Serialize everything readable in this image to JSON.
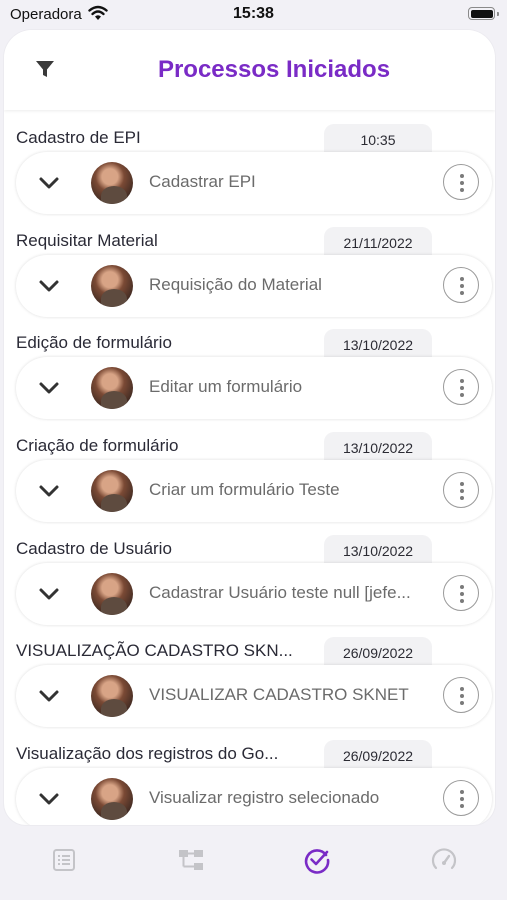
{
  "status_bar": {
    "carrier": "Operadora",
    "time": "15:38"
  },
  "header": {
    "title": "Processos Iniciados",
    "filter_icon": "filter-icon"
  },
  "colors": {
    "accent": "#7a2bc6",
    "tab_inactive": "#c4c4c8"
  },
  "processes": [
    {
      "title": "Cadastro de EPI",
      "date": "10:35",
      "task": "Cadastrar EPI"
    },
    {
      "title": "Requisitar Material",
      "date": "21/11/2022",
      "task": "Requisição do Material"
    },
    {
      "title": "Edição de formulário",
      "date": "13/10/2022",
      "task": "Editar um formulário"
    },
    {
      "title": "Criação de formulário",
      "date": "13/10/2022",
      "task": "Criar um formulário Teste"
    },
    {
      "title": "Cadastro de Usuário",
      "date": "13/10/2022",
      "task": "Cadastrar Usuário teste null [jefe..."
    },
    {
      "title": "VISUALIZAÇÃO CADASTRO SKN...",
      "date": "26/09/2022",
      "task": "VISUALIZAR CADASTRO SKNET"
    },
    {
      "title": "Visualização dos registros do Go...",
      "date": "26/09/2022",
      "task": "Visualizar registro selecionado"
    }
  ],
  "tabbar": {
    "active_index": 2,
    "tabs": [
      {
        "icon": "list-icon"
      },
      {
        "icon": "flow-icon"
      },
      {
        "icon": "check-circle-icon"
      },
      {
        "icon": "speedometer-icon"
      }
    ]
  }
}
